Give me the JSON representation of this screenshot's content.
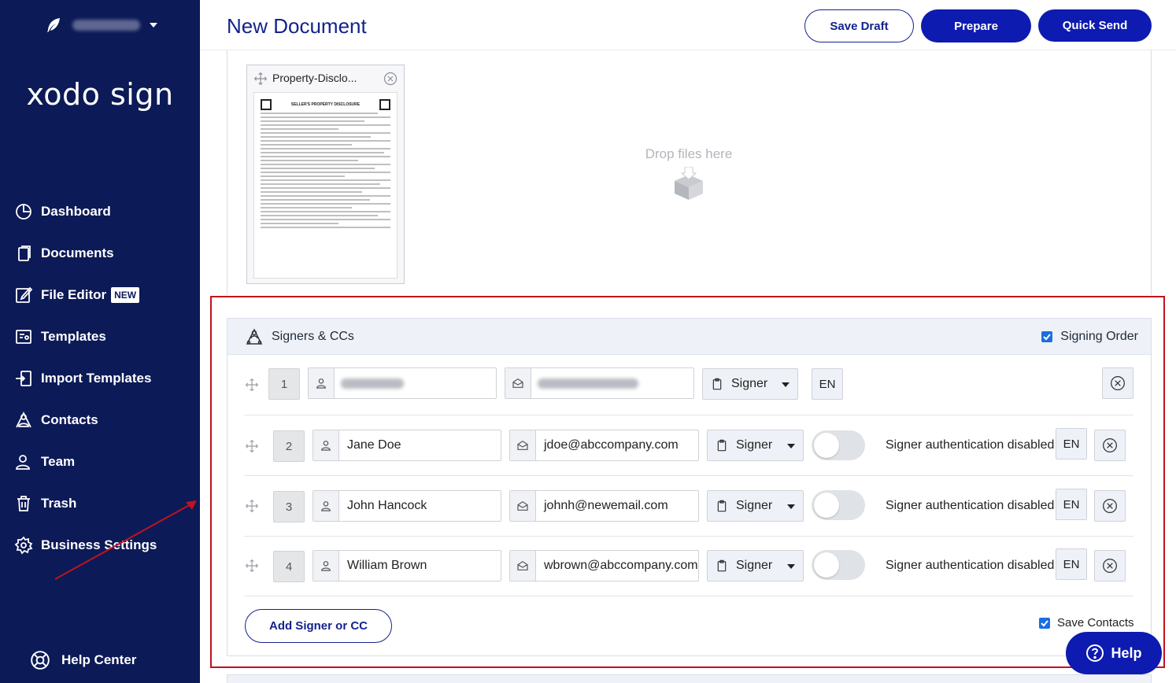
{
  "sidebar": {
    "brand": "xodo sign",
    "items": [
      {
        "label": "Dashboard"
      },
      {
        "label": "Documents"
      },
      {
        "label": "File Editor",
        "badge": "NEW"
      },
      {
        "label": "Templates"
      },
      {
        "label": "Import Templates"
      },
      {
        "label": "Contacts"
      },
      {
        "label": "Team"
      },
      {
        "label": "Trash"
      },
      {
        "label": "Business Settings"
      }
    ],
    "help_center": "Help Center"
  },
  "header": {
    "title": "New Document",
    "save_draft": "Save Draft",
    "prepare": "Prepare",
    "quick_send": "Quick Send"
  },
  "document": {
    "file_name": "Property-Disclo...",
    "thumb_title": "SELLER'S PROPERTY DISCLOSURE",
    "drop_text": "Drop files here"
  },
  "signers": {
    "title": "Signers & CCs",
    "signing_order": "Signing Order",
    "rows": [
      {
        "num": "1",
        "name": "",
        "email": "",
        "role": "Signer",
        "lang": "EN",
        "auth": ""
      },
      {
        "num": "2",
        "name": "Jane Doe",
        "email": "jdoe@abccompany.com",
        "role": "Signer",
        "lang": "EN",
        "auth": "Signer authentication disabled"
      },
      {
        "num": "3",
        "name": "John Hancock",
        "email": "johnh@newemail.com",
        "role": "Signer",
        "lang": "EN",
        "auth": "Signer authentication disabled"
      },
      {
        "num": "4",
        "name": "William Brown",
        "email": "wbrown@abccompany.com",
        "role": "Signer",
        "lang": "EN",
        "auth": "Signer authentication disabled"
      }
    ],
    "add_button": "Add Signer or CC",
    "save_contacts": "Save Contacts"
  },
  "help_button": "Help",
  "colors": {
    "sidebar_bg": "#0c1a57",
    "primary": "#0d1bb0",
    "highlight": "#c1121f"
  }
}
